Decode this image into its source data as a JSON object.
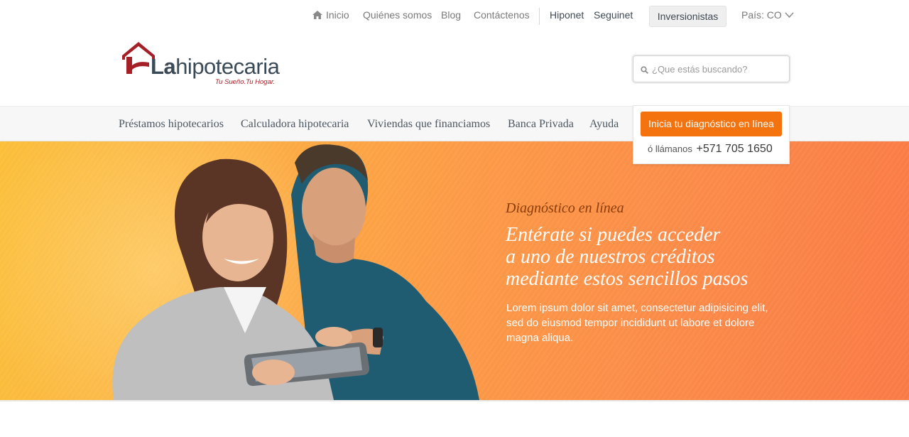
{
  "topnav": {
    "home": "Inicio",
    "about": "Quiénes somos",
    "blog": "Blog",
    "contact": "Contáctenos",
    "hiponet": "Hiponet",
    "seguinet": "Seguinet",
    "investors": "Inversionistas",
    "country_label": "País: CO"
  },
  "logo": {
    "brand_la": "La",
    "brand_rest": "hipotecaria",
    "tagline": "Tu Sueño.Tu Hogar."
  },
  "search": {
    "placeholder": "¿Que estás buscando?"
  },
  "mainnav": {
    "items": [
      "Préstamos hipotecarios",
      "Calculadora hipotecaria",
      "Viviendas que financiamos",
      "Banca Privada",
      "Ayuda"
    ]
  },
  "cta": {
    "button": "Inicia tu diagnóstico en línea",
    "call_prefix": "ó llámanos",
    "phone": "+571  705 1650"
  },
  "hero": {
    "kicker": "Diagnóstico en línea",
    "title_lines": [
      "Entérate si puedes acceder",
      "a uno de nuestros créditos",
      "mediante estos sencillos pasos"
    ],
    "body_lines": [
      "Lorem ipsum dolor sit amet, consectetur adipisicing elit,",
      "sed do eiusmod tempor incididunt ut labore et dolore",
      "magna aliqua."
    ]
  },
  "colors": {
    "brand_red": "#a51f28",
    "accent_orange": "#f4730f",
    "text_dark": "#3f4a54"
  }
}
